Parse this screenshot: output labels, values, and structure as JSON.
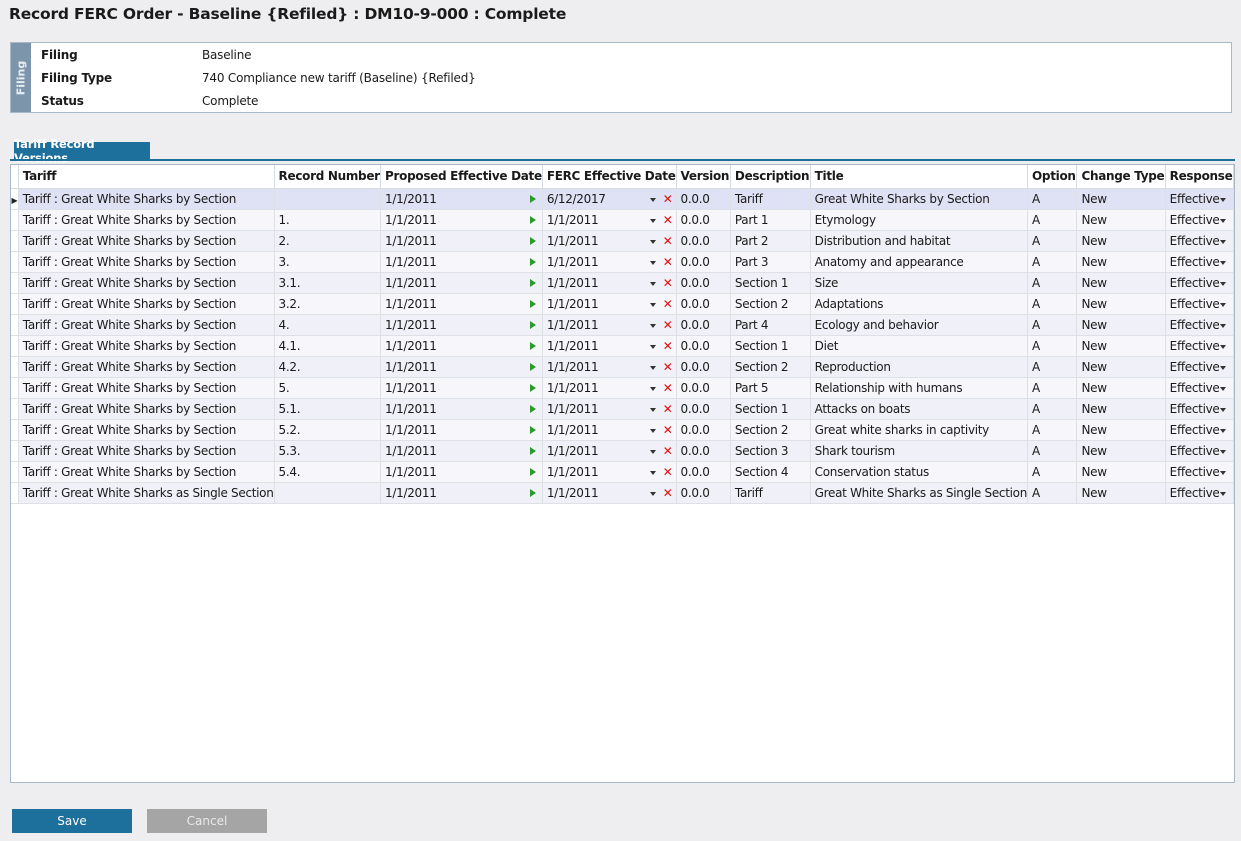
{
  "page": {
    "title": "Record FERC Order - Baseline {Refiled} : DM10-9-000 : Complete"
  },
  "filing": {
    "tab_label": "Filing",
    "fields": [
      {
        "label": "Filing",
        "value": "Baseline"
      },
      {
        "label": "Filing Type",
        "value": "740 Compliance new tariff (Baseline) {Refiled}"
      },
      {
        "label": "Status",
        "value": "Complete"
      }
    ]
  },
  "tabs": [
    {
      "label": "Tariff Record Versions",
      "active": true
    }
  ],
  "grid": {
    "columns": [
      "Tariff",
      "Record Number",
      "Proposed Effective Date",
      "FERC Effective Date",
      "Version",
      "Description",
      "Title",
      "Option",
      "Change Type",
      "Response"
    ],
    "rows": [
      {
        "tariff": "Tariff : Great White Sharks by Section",
        "record_number": "",
        "proposed_date": "1/1/2011",
        "ferc_date": "6/12/2017",
        "version": "0.0.0",
        "description": "Tariff",
        "title": "Great White Sharks by Section",
        "option": "A",
        "change_type": "New",
        "response": "Effective"
      },
      {
        "tariff": "Tariff : Great White Sharks by Section",
        "record_number": "1.",
        "proposed_date": "1/1/2011",
        "ferc_date": "1/1/2011",
        "version": "0.0.0",
        "description": "Part 1",
        "title": "Etymology",
        "option": "A",
        "change_type": "New",
        "response": "Effective"
      },
      {
        "tariff": "Tariff : Great White Sharks by Section",
        "record_number": "2.",
        "proposed_date": "1/1/2011",
        "ferc_date": "1/1/2011",
        "version": "0.0.0",
        "description": "Part 2",
        "title": "Distribution and habitat",
        "option": "A",
        "change_type": "New",
        "response": "Effective"
      },
      {
        "tariff": "Tariff : Great White Sharks by Section",
        "record_number": "3.",
        "proposed_date": "1/1/2011",
        "ferc_date": "1/1/2011",
        "version": "0.0.0",
        "description": "Part 3",
        "title": "Anatomy and appearance",
        "option": "A",
        "change_type": "New",
        "response": "Effective"
      },
      {
        "tariff": "Tariff : Great White Sharks by Section",
        "record_number": "3.1.",
        "proposed_date": "1/1/2011",
        "ferc_date": "1/1/2011",
        "version": "0.0.0",
        "description": "Section 1",
        "title": "Size",
        "option": "A",
        "change_type": "New",
        "response": "Effective"
      },
      {
        "tariff": "Tariff : Great White Sharks by Section",
        "record_number": "3.2.",
        "proposed_date": "1/1/2011",
        "ferc_date": "1/1/2011",
        "version": "0.0.0",
        "description": "Section 2",
        "title": "Adaptations",
        "option": "A",
        "change_type": "New",
        "response": "Effective"
      },
      {
        "tariff": "Tariff : Great White Sharks by Section",
        "record_number": "4.",
        "proposed_date": "1/1/2011",
        "ferc_date": "1/1/2011",
        "version": "0.0.0",
        "description": "Part 4",
        "title": "Ecology and behavior",
        "option": "A",
        "change_type": "New",
        "response": "Effective"
      },
      {
        "tariff": "Tariff : Great White Sharks by Section",
        "record_number": "4.1.",
        "proposed_date": "1/1/2011",
        "ferc_date": "1/1/2011",
        "version": "0.0.0",
        "description": "Section 1",
        "title": "Diet",
        "option": "A",
        "change_type": "New",
        "response": "Effective"
      },
      {
        "tariff": "Tariff : Great White Sharks by Section",
        "record_number": "4.2.",
        "proposed_date": "1/1/2011",
        "ferc_date": "1/1/2011",
        "version": "0.0.0",
        "description": "Section 2",
        "title": "Reproduction",
        "option": "A",
        "change_type": "New",
        "response": "Effective"
      },
      {
        "tariff": "Tariff : Great White Sharks by Section",
        "record_number": "5.",
        "proposed_date": "1/1/2011",
        "ferc_date": "1/1/2011",
        "version": "0.0.0",
        "description": "Part 5",
        "title": "Relationship with humans",
        "option": "A",
        "change_type": "New",
        "response": "Effective"
      },
      {
        "tariff": "Tariff : Great White Sharks by Section",
        "record_number": "5.1.",
        "proposed_date": "1/1/2011",
        "ferc_date": "1/1/2011",
        "version": "0.0.0",
        "description": "Section 1",
        "title": "Attacks on boats",
        "option": "A",
        "change_type": "New",
        "response": "Effective"
      },
      {
        "tariff": "Tariff : Great White Sharks by Section",
        "record_number": "5.2.",
        "proposed_date": "1/1/2011",
        "ferc_date": "1/1/2011",
        "version": "0.0.0",
        "description": "Section 2",
        "title": "Great white sharks in captivity",
        "option": "A",
        "change_type": "New",
        "response": "Effective"
      },
      {
        "tariff": "Tariff : Great White Sharks by Section",
        "record_number": "5.3.",
        "proposed_date": "1/1/2011",
        "ferc_date": "1/1/2011",
        "version": "0.0.0",
        "description": "Section 3",
        "title": "Shark tourism",
        "option": "A",
        "change_type": "New",
        "response": "Effective"
      },
      {
        "tariff": "Tariff : Great White Sharks by Section",
        "record_number": "5.4.",
        "proposed_date": "1/1/2011",
        "ferc_date": "1/1/2011",
        "version": "0.0.0",
        "description": "Section 4",
        "title": "Conservation status",
        "option": "A",
        "change_type": "New",
        "response": "Effective"
      },
      {
        "tariff": "Tariff : Great White Sharks as Single Section",
        "record_number": "",
        "proposed_date": "1/1/2011",
        "ferc_date": "1/1/2011",
        "version": "0.0.0",
        "description": "Tariff",
        "title": "Great White Sharks as Single Section",
        "option": "A",
        "change_type": "New",
        "response": "Effective"
      }
    ],
    "selected_row": 0
  },
  "buttons": {
    "save_label": "Save",
    "cancel_label": "Cancel"
  },
  "colors": {
    "accent": "#1d6f9c",
    "filing_tab": "#7d95ab",
    "play_icon": "#2c9a2c",
    "clear_icon": "#e01010",
    "cancel_button": "#a5a5a5"
  },
  "icons": {
    "row_indicator": "row-indicator-arrow-icon",
    "date_set": "play-icon",
    "dropdown": "chevron-down-icon",
    "clear": "close-icon"
  }
}
